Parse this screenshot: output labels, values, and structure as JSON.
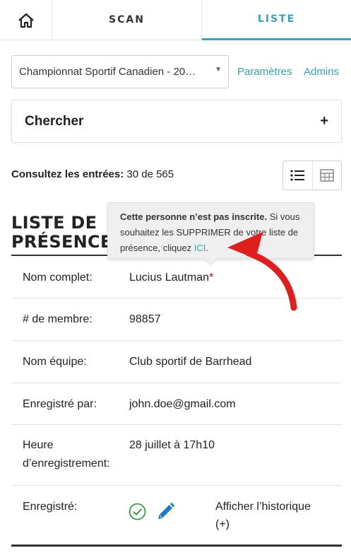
{
  "nav": {
    "scan_label": "SCAN",
    "list_label": "LISTE",
    "home_icon": "home-icon"
  },
  "event": {
    "selected": "Championnat Sportif Canadien - 20…",
    "params_link": "Paramètres",
    "admins_link": "Admins"
  },
  "search": {
    "title": "Chercher",
    "expand": "+"
  },
  "entries": {
    "label": "Consultez les entrées:",
    "count": "30 de 565"
  },
  "list": {
    "title_line1": "LISTE DE",
    "title_line2": "PRÉSENCE"
  },
  "tooltip": {
    "bold": "Cette personne n’est pas inscrite.",
    "text": " Si vous souhaitez les SUPPRIMER de votre liste de présence, cliquez ",
    "link": "ICI",
    "end": "."
  },
  "fields": {
    "name_label": "Nom complet:",
    "name_value": "Lucius Lautman",
    "name_required": "*",
    "member_label": "# de membre:",
    "member_value": "98857",
    "team_label": "Nom équipe:",
    "team_value": "Club sportif de Barrhead",
    "by_label": "Enregistré par:",
    "by_value": "john.doe@gmail.com",
    "time_label_1": "Heure",
    "time_label_2": "d’enregistrement:",
    "time_value": "28 juillet à 17h10",
    "registered_label": "Enregistré:",
    "history_line1": "Afficher l’historique",
    "history_line2": "(+)"
  },
  "colors": {
    "accent": "#3aa0b8",
    "success": "#2ea043",
    "edit": "#1f78c8",
    "annotation": "#e01e1e"
  }
}
